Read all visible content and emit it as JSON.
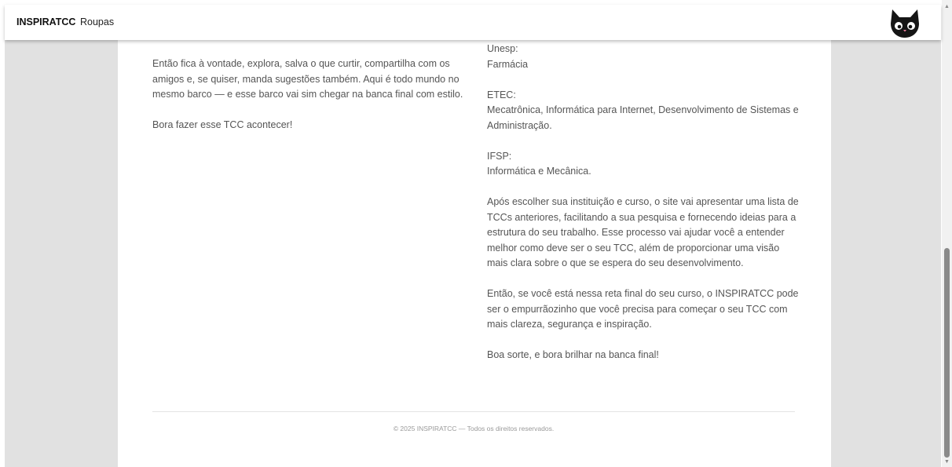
{
  "navbar": {
    "brand": "INSPIRATCC",
    "links": [
      "Roupas"
    ],
    "avatar_icon": "black-cat-icon"
  },
  "left_column": {
    "paragraphs": [
      "Então fica à vontade, explora, salva o que curtir, compartilha com os amigos e, se quiser, manda sugestões também. Aqui é todo mundo no mesmo barco — e esse barco vai sim chegar na banca final com estilo.",
      "Bora fazer esse TCC acontecer!"
    ]
  },
  "right_column": {
    "unesp_label": "Unesp:",
    "unesp_courses": "Farmácia",
    "etec_label": "ETEC:",
    "etec_courses": "Mecatrônica, Informática para Internet, Desenvolvimento de Sistemas e Administração.",
    "ifsp_label": "IFSP:",
    "ifsp_courses": "Informática e Mecânica.",
    "paragraph_1": "Após escolher sua instituição e curso, o site vai apresentar uma lista de TCCs anteriores, facilitando a sua pesquisa e fornecendo ideias para a estrutura do seu trabalho. Esse processo vai ajudar você a entender melhor como deve ser o seu TCC, além de proporcionar uma visão mais clara sobre o que se espera do seu desenvolvimento.",
    "paragraph_2": "Então, se você está nessa reta final do seu curso, o INSPIRATCC pode ser o empurrãozinho que você precisa para começar o seu TCC com mais clareza, segurança e inspiração.",
    "paragraph_3": "Boa sorte, e bora brilhar na banca final!"
  },
  "footer": {
    "text": "© 2025 INSPIRATCC — Todos os direitos reservados."
  },
  "colors": {
    "page_background": "#e1e1e1",
    "card_background": "#ffffff",
    "text": "#555555",
    "scroll_thumb": "#8a8a8a"
  }
}
